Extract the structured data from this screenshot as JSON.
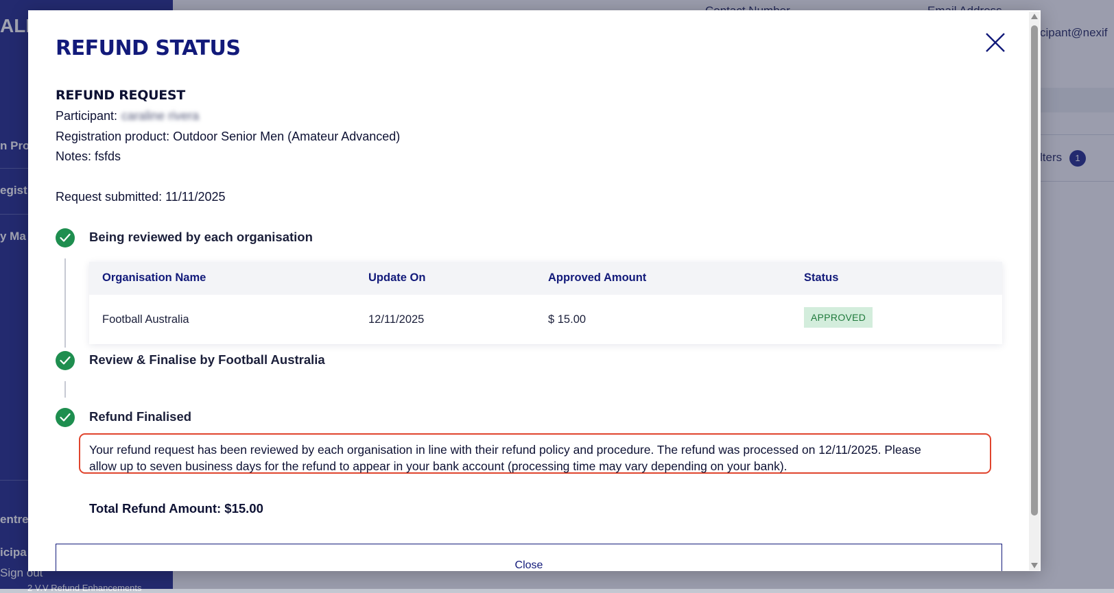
{
  "background": {
    "sidebar_fragments": [
      "ALL",
      "n Proc",
      "egist",
      "y Ma",
      "entre",
      "icipa",
      "Sign out",
      "2 V.V Refund Enhancements"
    ],
    "header_fragments": [
      "Contact Number",
      "Email Address",
      "cipant@nexif"
    ],
    "filters_label": "lters",
    "filters_count": "1"
  },
  "modal": {
    "title": "REFUND STATUS",
    "close_icon": "close-icon",
    "section_title": "REFUND REQUEST",
    "participant_label": "Participant:",
    "participant_name": "caraline rivera",
    "registration_product": "Registration product: Outdoor Senior Men (Amateur Advanced)",
    "notes": "Notes: fsfds",
    "request_submitted": "Request submitted: 11/11/2025",
    "steps": [
      {
        "label": "Being reviewed by each organisation",
        "icon": "check-icon"
      },
      {
        "label": "Review & Finalise by Football Australia",
        "icon": "check-icon"
      },
      {
        "label": "Refund Finalised",
        "icon": "check-icon"
      }
    ],
    "table": {
      "headers": [
        "Organisation Name",
        "Update On",
        "Approved Amount",
        "Status"
      ],
      "rows": [
        {
          "organisation": "Football Australia",
          "updated_on": "12/11/2025",
          "amount": "$ 15.00",
          "status": "APPROVED"
        }
      ]
    },
    "notice_line1": "Your refund request has been reviewed by each organisation in line with their refund policy and procedure. The refund was processed on 12/11/2025. Please",
    "notice_line2": "allow up to seven business days for the refund to appear in your bank account (processing time may vary depending on your bank).",
    "total_refund": "Total Refund Amount: $15.00",
    "close_button": "Close"
  },
  "colors": {
    "brand_navy": "#121a7a",
    "success_green": "#1e8e4f",
    "highlight_red": "#e0442d",
    "approved_bg": "#d3eddc"
  }
}
